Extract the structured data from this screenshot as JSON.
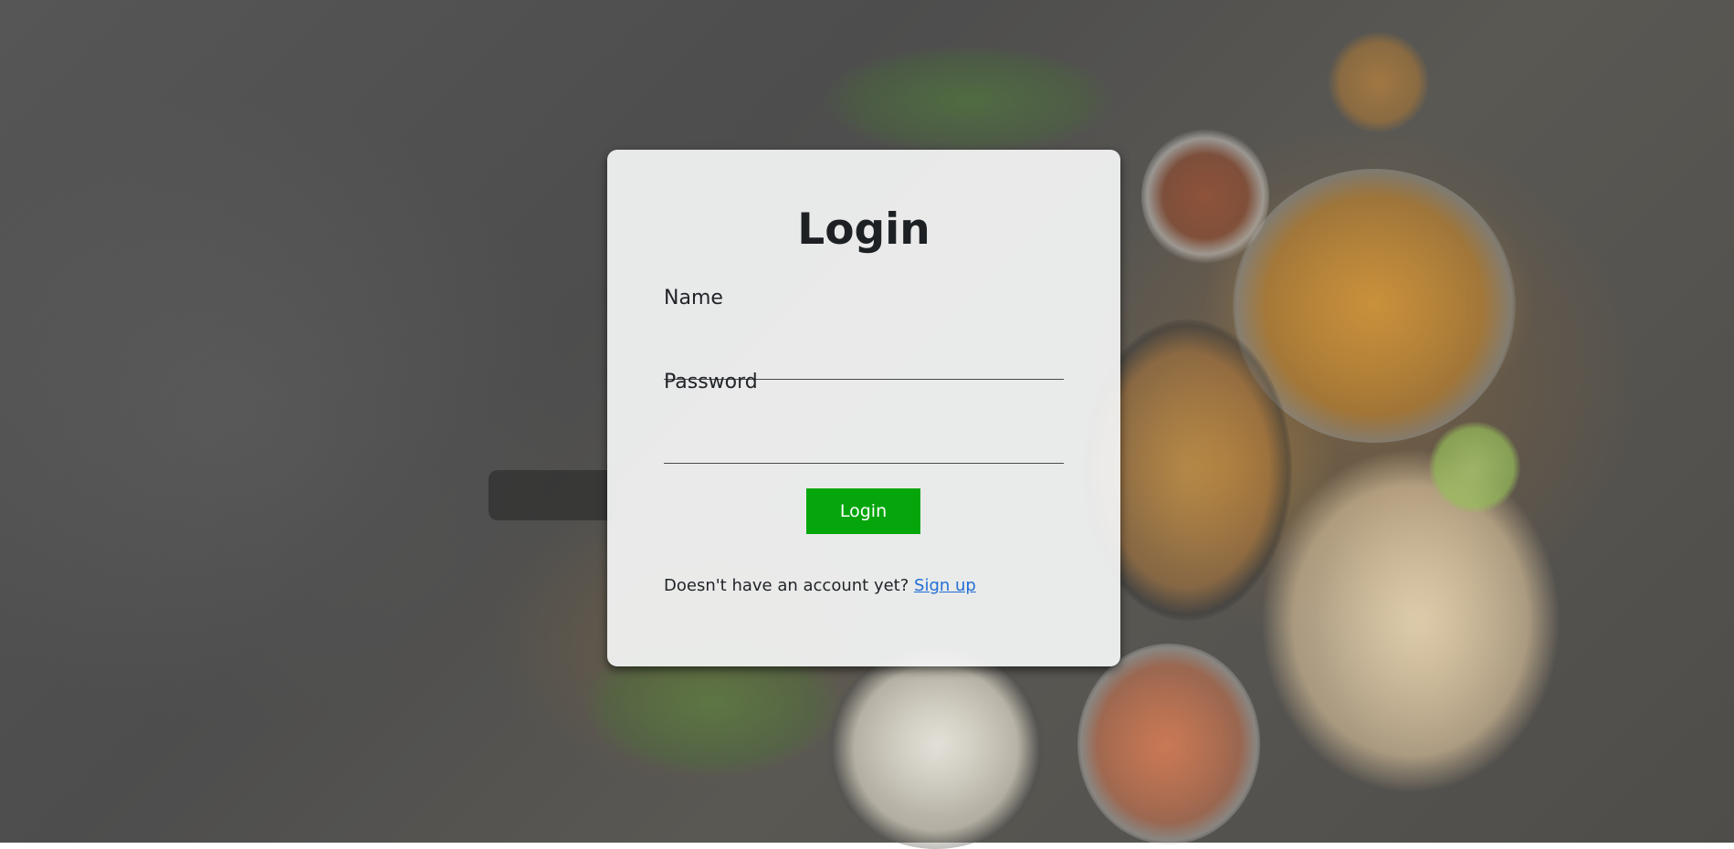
{
  "login_form": {
    "title": "Login",
    "name_label": "Name",
    "name_value": "",
    "password_label": "Password",
    "password_value": "",
    "submit_label": "Login",
    "signup_prompt": "Doesn't have an account yet?",
    "signup_link": "Sign up"
  },
  "colors": {
    "button_bg": "#04a60b",
    "link": "#1f6fd6",
    "card_bg": "#f4f5f5"
  }
}
